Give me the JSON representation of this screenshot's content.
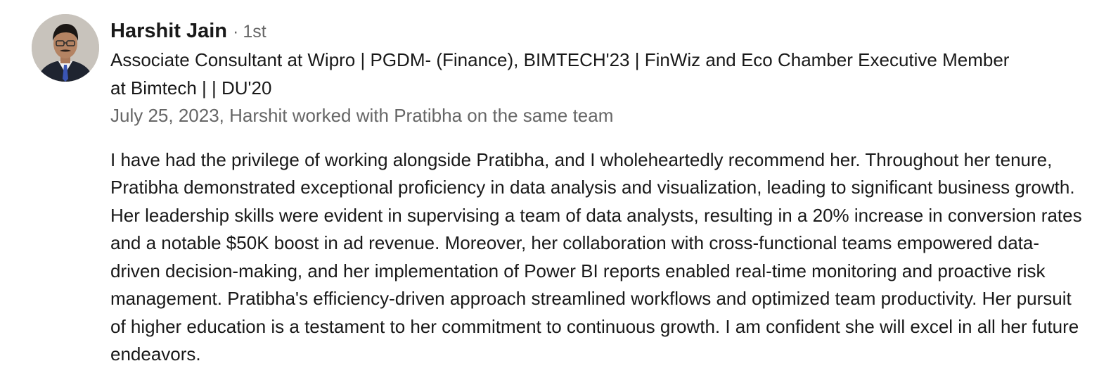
{
  "recommendation": {
    "author": {
      "name": "Harshit Jain",
      "degree_separator": "·",
      "degree": "1st",
      "headline": "Associate Consultant at Wipro | PGDM- (Finance), BIMTECH'23 | FinWiz and Eco Chamber Executive Member at Bimtech | | DU'20"
    },
    "meta": "July 25, 2023, Harshit worked with Pratibha on the same team",
    "text": "I have had the privilege of working alongside Pratibha, and I wholeheartedly recommend her. Throughout her tenure, Pratibha demonstrated exceptional proficiency in data analysis and visualization, leading to significant business growth. Her leadership skills were evident in supervising a team of data analysts, resulting in a 20% increase in conversion rates and a notable $50K boost in ad revenue. Moreover, her collaboration with cross-functional teams empowered data-driven decision-making, and her implementation of Power BI reports enabled real-time monitoring and proactive risk management. Pratibha's efficiency-driven approach streamlined workflows and optimized team productivity. Her pursuit of higher education is a testament to her commitment to continuous growth. I am confident she will excel in all her future endeavors."
  },
  "colors": {
    "text_primary": "#191919",
    "text_secondary": "#666666",
    "background": "#ffffff"
  }
}
